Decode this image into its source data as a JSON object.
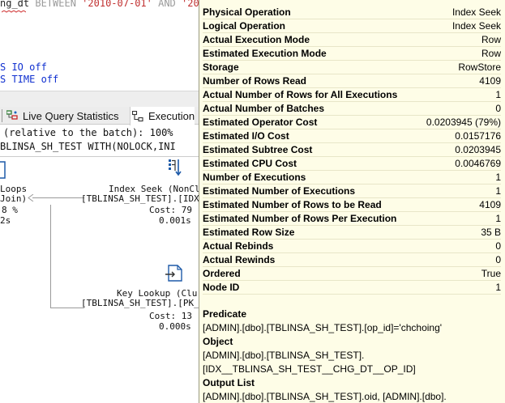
{
  "editor": {
    "line1_a": "ng_dt ",
    "line1_kw": "BETWEEN",
    "line1_s1": "'2010-07-01'",
    "line1_and": "AND",
    "line1_s2": "'202",
    "line2_a": "S ",
    "line2_kw": "IO",
    "line2_b": " off",
    "line3_a": "S ",
    "line3_kw": "TIME",
    "line3_b": " off"
  },
  "tabs": {
    "live_query_statistics": "Live Query Statistics",
    "execution_plan": "Execution"
  },
  "plan": {
    "header_line1": "(relative to the batch): 100%",
    "header_line2": "BLINSA_SH_TEST WITH(NOLOCK,INI",
    "loops": {
      "name": "Loops",
      "type": "Join)",
      "cost": "8 %",
      "time": "2s"
    },
    "index_seek": {
      "name": "Index Seek (NonCl",
      "object": "[TBLINSA_SH_TEST].[IDX",
      "cost": "Cost: 79",
      "time": "0.001s"
    },
    "key_lookup": {
      "name": "Key Lookup (Clu",
      "object": "[TBLINSA_SH_TEST].[PK_",
      "cost": "Cost: 13",
      "time": "0.000s"
    }
  },
  "tooltip": {
    "properties": [
      {
        "k": "Physical Operation",
        "v": "Index Seek"
      },
      {
        "k": "Logical Operation",
        "v": "Index Seek"
      },
      {
        "k": "Actual Execution Mode",
        "v": "Row"
      },
      {
        "k": "Estimated Execution Mode",
        "v": "Row"
      },
      {
        "k": "Storage",
        "v": "RowStore"
      },
      {
        "k": "Number of Rows Read",
        "v": "4109"
      },
      {
        "k": "Actual Number of Rows for All Executions",
        "v": "1"
      },
      {
        "k": "Actual Number of Batches",
        "v": "0"
      },
      {
        "k": "Estimated Operator Cost",
        "v": "0.0203945 (79%)"
      },
      {
        "k": "Estimated I/O Cost",
        "v": "0.0157176"
      },
      {
        "k": "Estimated Subtree Cost",
        "v": "0.0203945"
      },
      {
        "k": "Estimated CPU Cost",
        "v": "0.0046769"
      },
      {
        "k": "Number of Executions",
        "v": "1"
      },
      {
        "k": "Estimated Number of Executions",
        "v": "1"
      },
      {
        "k": "Estimated Number of Rows to be Read",
        "v": "4109"
      },
      {
        "k": "Estimated Number of Rows Per Execution",
        "v": "1"
      },
      {
        "k": "Estimated Row Size",
        "v": "35 B"
      },
      {
        "k": "Actual Rebinds",
        "v": "0"
      },
      {
        "k": "Actual Rewinds",
        "v": "0"
      },
      {
        "k": "Ordered",
        "v": "True"
      },
      {
        "k": "Node ID",
        "v": "1"
      }
    ],
    "predicate_label": "Predicate",
    "predicate_value": "[ADMIN].[dbo].[TBLINSA_SH_TEST].[op_id]='chchoing'",
    "object_label": "Object",
    "object_value_1": "[ADMIN].[dbo].[TBLINSA_SH_TEST].",
    "object_value_2": "[IDX__TBLINSA_SH_TEST__CHG_DT__OP_ID]",
    "output_label": "Output List",
    "output_value": "[ADMIN].[dbo].[TBLINSA_SH_TEST].oid, [ADMIN].[dbo]."
  }
}
